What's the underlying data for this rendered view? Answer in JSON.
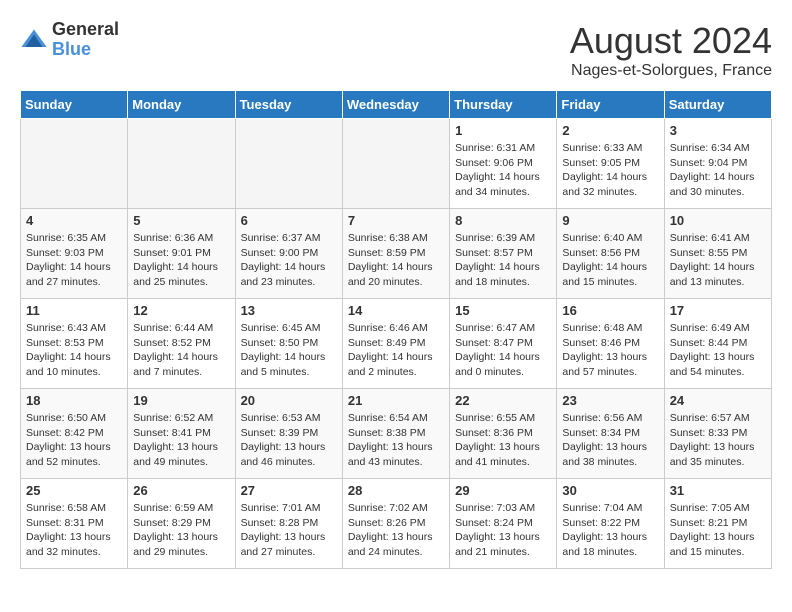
{
  "header": {
    "logo_general": "General",
    "logo_blue": "Blue",
    "month_title": "August 2024",
    "location": "Nages-et-Solorgues, France"
  },
  "weekdays": [
    "Sunday",
    "Monday",
    "Tuesday",
    "Wednesday",
    "Thursday",
    "Friday",
    "Saturday"
  ],
  "weeks": [
    [
      {
        "day": "",
        "empty": true
      },
      {
        "day": "",
        "empty": true
      },
      {
        "day": "",
        "empty": true
      },
      {
        "day": "",
        "empty": true
      },
      {
        "day": "1",
        "sunrise": "6:31 AM",
        "sunset": "9:06 PM",
        "daylight": "14 hours and 34 minutes."
      },
      {
        "day": "2",
        "sunrise": "6:33 AM",
        "sunset": "9:05 PM",
        "daylight": "14 hours and 32 minutes."
      },
      {
        "day": "3",
        "sunrise": "6:34 AM",
        "sunset": "9:04 PM",
        "daylight": "14 hours and 30 minutes."
      }
    ],
    [
      {
        "day": "4",
        "sunrise": "6:35 AM",
        "sunset": "9:03 PM",
        "daylight": "14 hours and 27 minutes."
      },
      {
        "day": "5",
        "sunrise": "6:36 AM",
        "sunset": "9:01 PM",
        "daylight": "14 hours and 25 minutes."
      },
      {
        "day": "6",
        "sunrise": "6:37 AM",
        "sunset": "9:00 PM",
        "daylight": "14 hours and 23 minutes."
      },
      {
        "day": "7",
        "sunrise": "6:38 AM",
        "sunset": "8:59 PM",
        "daylight": "14 hours and 20 minutes."
      },
      {
        "day": "8",
        "sunrise": "6:39 AM",
        "sunset": "8:57 PM",
        "daylight": "14 hours and 18 minutes."
      },
      {
        "day": "9",
        "sunrise": "6:40 AM",
        "sunset": "8:56 PM",
        "daylight": "14 hours and 15 minutes."
      },
      {
        "day": "10",
        "sunrise": "6:41 AM",
        "sunset": "8:55 PM",
        "daylight": "14 hours and 13 minutes."
      }
    ],
    [
      {
        "day": "11",
        "sunrise": "6:43 AM",
        "sunset": "8:53 PM",
        "daylight": "14 hours and 10 minutes."
      },
      {
        "day": "12",
        "sunrise": "6:44 AM",
        "sunset": "8:52 PM",
        "daylight": "14 hours and 7 minutes."
      },
      {
        "day": "13",
        "sunrise": "6:45 AM",
        "sunset": "8:50 PM",
        "daylight": "14 hours and 5 minutes."
      },
      {
        "day": "14",
        "sunrise": "6:46 AM",
        "sunset": "8:49 PM",
        "daylight": "14 hours and 2 minutes."
      },
      {
        "day": "15",
        "sunrise": "6:47 AM",
        "sunset": "8:47 PM",
        "daylight": "14 hours and 0 minutes."
      },
      {
        "day": "16",
        "sunrise": "6:48 AM",
        "sunset": "8:46 PM",
        "daylight": "13 hours and 57 minutes."
      },
      {
        "day": "17",
        "sunrise": "6:49 AM",
        "sunset": "8:44 PM",
        "daylight": "13 hours and 54 minutes."
      }
    ],
    [
      {
        "day": "18",
        "sunrise": "6:50 AM",
        "sunset": "8:42 PM",
        "daylight": "13 hours and 52 minutes."
      },
      {
        "day": "19",
        "sunrise": "6:52 AM",
        "sunset": "8:41 PM",
        "daylight": "13 hours and 49 minutes."
      },
      {
        "day": "20",
        "sunrise": "6:53 AM",
        "sunset": "8:39 PM",
        "daylight": "13 hours and 46 minutes."
      },
      {
        "day": "21",
        "sunrise": "6:54 AM",
        "sunset": "8:38 PM",
        "daylight": "13 hours and 43 minutes."
      },
      {
        "day": "22",
        "sunrise": "6:55 AM",
        "sunset": "8:36 PM",
        "daylight": "13 hours and 41 minutes."
      },
      {
        "day": "23",
        "sunrise": "6:56 AM",
        "sunset": "8:34 PM",
        "daylight": "13 hours and 38 minutes."
      },
      {
        "day": "24",
        "sunrise": "6:57 AM",
        "sunset": "8:33 PM",
        "daylight": "13 hours and 35 minutes."
      }
    ],
    [
      {
        "day": "25",
        "sunrise": "6:58 AM",
        "sunset": "8:31 PM",
        "daylight": "13 hours and 32 minutes."
      },
      {
        "day": "26",
        "sunrise": "6:59 AM",
        "sunset": "8:29 PM",
        "daylight": "13 hours and 29 minutes."
      },
      {
        "day": "27",
        "sunrise": "7:01 AM",
        "sunset": "8:28 PM",
        "daylight": "13 hours and 27 minutes."
      },
      {
        "day": "28",
        "sunrise": "7:02 AM",
        "sunset": "8:26 PM",
        "daylight": "13 hours and 24 minutes."
      },
      {
        "day": "29",
        "sunrise": "7:03 AM",
        "sunset": "8:24 PM",
        "daylight": "13 hours and 21 minutes."
      },
      {
        "day": "30",
        "sunrise": "7:04 AM",
        "sunset": "8:22 PM",
        "daylight": "13 hours and 18 minutes."
      },
      {
        "day": "31",
        "sunrise": "7:05 AM",
        "sunset": "8:21 PM",
        "daylight": "13 hours and 15 minutes."
      }
    ]
  ]
}
